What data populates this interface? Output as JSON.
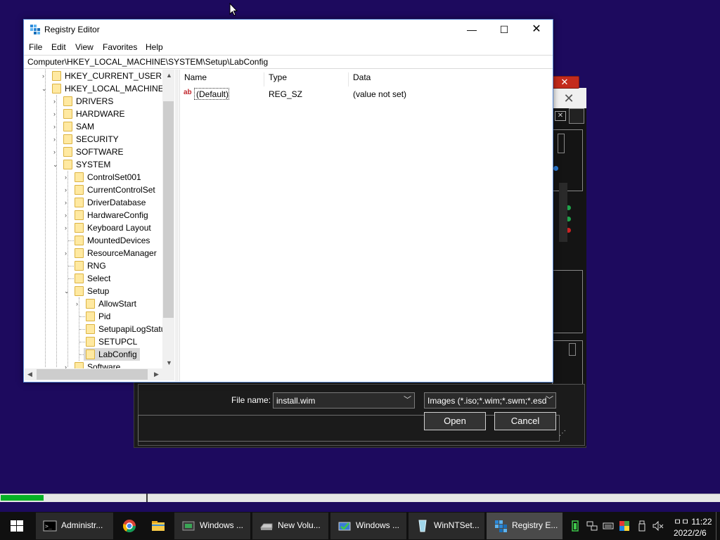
{
  "registry_editor": {
    "title": "Registry Editor",
    "menu": [
      "File",
      "Edit",
      "View",
      "Favorites",
      "Help"
    ],
    "address": "Computer\\HKEY_LOCAL_MACHINE\\SYSTEM\\Setup\\LabConfig",
    "tree": [
      {
        "label": "HKEY_CURRENT_USER",
        "state": "collapsed"
      },
      {
        "label": "HKEY_LOCAL_MACHINE",
        "state": "expanded"
      },
      {
        "label": "DRIVERS",
        "state": "collapsed"
      },
      {
        "label": "HARDWARE",
        "state": "collapsed"
      },
      {
        "label": "SAM",
        "state": "collapsed"
      },
      {
        "label": "SECURITY",
        "state": "collapsed"
      },
      {
        "label": "SOFTWARE",
        "state": "collapsed"
      },
      {
        "label": "SYSTEM",
        "state": "expanded"
      },
      {
        "label": "ControlSet001",
        "state": "collapsed"
      },
      {
        "label": "CurrentControlSet",
        "state": "collapsed"
      },
      {
        "label": "DriverDatabase",
        "state": "collapsed"
      },
      {
        "label": "HardwareConfig",
        "state": "collapsed"
      },
      {
        "label": "Keyboard Layout",
        "state": "collapsed"
      },
      {
        "label": "MountedDevices",
        "state": "leaf"
      },
      {
        "label": "ResourceManager",
        "state": "collapsed"
      },
      {
        "label": "RNG",
        "state": "leaf"
      },
      {
        "label": "Select",
        "state": "leaf"
      },
      {
        "label": "Setup",
        "state": "expanded"
      },
      {
        "label": "AllowStart",
        "state": "collapsed"
      },
      {
        "label": "Pid",
        "state": "leaf"
      },
      {
        "label": "SetupapiLogStatu",
        "state": "leaf"
      },
      {
        "label": "SETUPCL",
        "state": "leaf"
      },
      {
        "label": "LabConfig",
        "state": "selected"
      },
      {
        "label": "Software",
        "state": "collapsed"
      }
    ],
    "columns": [
      "Name",
      "Type",
      "Data"
    ],
    "values": [
      {
        "name": "(Default)",
        "type": "REG_SZ",
        "data": "(value not set)",
        "icon": "string-value-icon"
      }
    ]
  },
  "file_dialog": {
    "file_name_label": "File name:",
    "file_name_value": "install.wim",
    "filter_value": "Images (*.iso;*.wim;*.swm;*.esd",
    "open_label": "Open",
    "cancel_label": "Cancel",
    "close_glyph": "✕",
    "red_close_glyph": "✕"
  },
  "progress": {
    "value": 0.06,
    "color": "#06b025"
  },
  "taskbar": {
    "items": [
      {
        "label": "Administr...",
        "icon": "cmd-icon",
        "active": false
      },
      {
        "label": "",
        "icon": "chrome-icon",
        "active": false
      },
      {
        "label": "",
        "icon": "file-explorer-icon",
        "active": false
      },
      {
        "label": "Windows ...",
        "icon": "windows-app-icon",
        "active": false
      },
      {
        "label": "New Volu...",
        "icon": "drive-icon",
        "active": false
      },
      {
        "label": "Windows ...",
        "icon": "windows-setup-icon",
        "active": false
      },
      {
        "label": "WinNTSet...",
        "icon": "winntsetup-icon",
        "active": false
      },
      {
        "label": "Registry E...",
        "icon": "registry-icon",
        "active": true
      }
    ],
    "clock_time": "ㅁㅁ 11:22",
    "clock_date": "2022/2/6"
  },
  "colors": {
    "desktop": "#1d0a5e",
    "accent": "#0078d7",
    "taskbar": "#101010"
  }
}
